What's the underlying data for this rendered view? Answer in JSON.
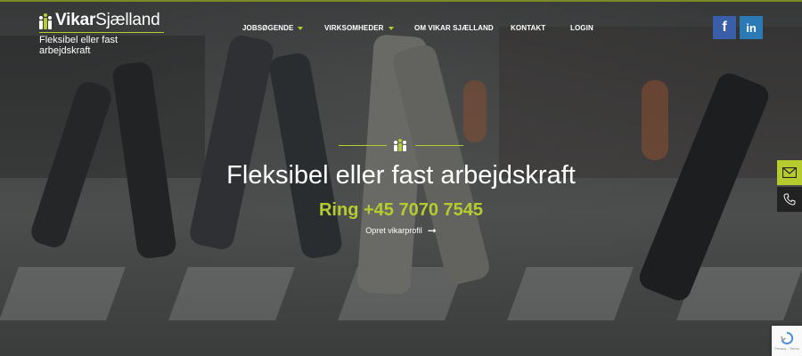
{
  "brand": {
    "name_bold": "Vikar",
    "name_rest": "Sjælland",
    "tagline": "Fleksibel eller fast arbejdskraft",
    "accent_color": "#b6cc2e"
  },
  "nav": {
    "items": [
      {
        "label": "JOBSØGENDE",
        "has_dropdown": true
      },
      {
        "label": "VIRKSOMHEDER",
        "has_dropdown": true
      },
      {
        "label": "OM VIKAR SJÆLLAND",
        "has_dropdown": false
      },
      {
        "label": "KONTAKT",
        "has_dropdown": false
      },
      {
        "label": "LOGIN",
        "has_dropdown": false
      }
    ]
  },
  "social": {
    "facebook_label": "f",
    "linkedin_label": "in",
    "facebook_color": "#3b5ea8",
    "linkedin_color": "#2b7ab5"
  },
  "hero": {
    "headline": "Fleksibel eller fast arbejdskraft",
    "phone": "Ring +45 7070 7545",
    "cta_label": "Opret vikarprofil",
    "cta_arrow": "➞"
  },
  "side_tabs": {
    "mail_icon": "envelope-icon",
    "phone_icon": "phone-icon"
  },
  "recaptcha": {
    "footer": "Privacy - Terms"
  }
}
